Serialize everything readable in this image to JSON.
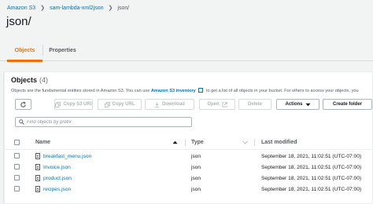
{
  "breadcrumb": {
    "root": "Amazon S3",
    "bucket": "sam-lambda-xml2json",
    "current": "json/",
    "separator": "❯"
  },
  "page_title": "json/",
  "tabs": [
    {
      "label": "Objects"
    },
    {
      "label": "Properties"
    }
  ],
  "objects_panel": {
    "heading": "Objects",
    "count": "(4)",
    "description_prefix": "Objects are the fundamental entities stored in Amazon S3. You can use",
    "description_link": "Amazon S3 inventory",
    "description_suffix": "to get a list of all objects in your bucket. For others to access your objects, you",
    "buttons": {
      "copy_uri": "Copy S3 URI",
      "copy_url": "Copy URL",
      "download": "Download",
      "open": "Open",
      "delete": "Delete",
      "actions": "Actions",
      "create_folder": "Create folder"
    },
    "search_placeholder": "Find objects by prefix",
    "columns": {
      "name": "Name",
      "type": "Type",
      "last_modified": "Last modified"
    },
    "rows": [
      {
        "name": "breakfast_menu.json",
        "type": "json",
        "last_modified": "September 18, 2021, 11:02:51 (UTC-07:00)"
      },
      {
        "name": "Invoice.json",
        "type": "json",
        "last_modified": "September 18, 2021, 11:02:51 (UTC-07:00)"
      },
      {
        "name": "product.json",
        "type": "json",
        "last_modified": "September 18, 2021, 11:02:51 (UTC-07:00)"
      },
      {
        "name": "recipes.json",
        "type": "json",
        "last_modified": "September 18, 2021, 11:02:51 (UTC-07:00)"
      }
    ]
  },
  "colors": {
    "link": "#0073bb",
    "accent": "#ec7211",
    "background": "#f2f3f3"
  },
  "icons": [
    "refresh-icon",
    "copy-icon",
    "download-icon",
    "external-link-icon",
    "caret-down-icon",
    "search-icon",
    "sort-ascending-icon",
    "file-icon"
  ]
}
